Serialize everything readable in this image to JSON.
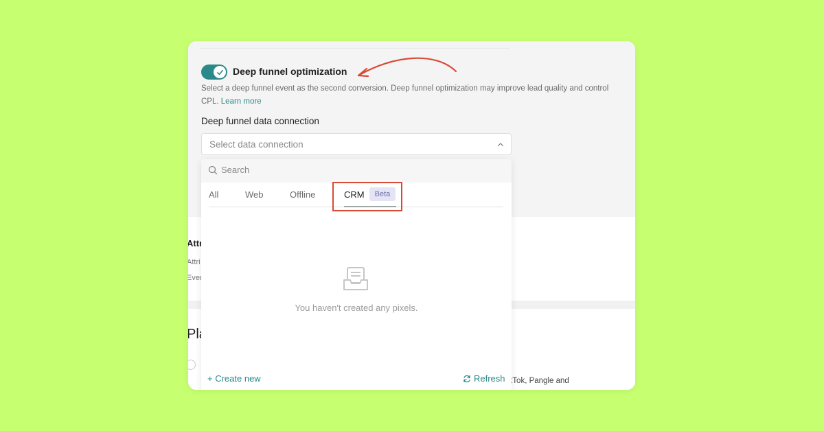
{
  "colors": {
    "page_background": "#c6ff70",
    "accent": "#2b8a89",
    "annotation": "#d94a36",
    "beta_badge_bg": "#e4e4f6"
  },
  "deep_funnel": {
    "toggle_on": true,
    "title": "Deep funnel optimization",
    "description": "Select a deep funnel event as the second conversion. Deep funnel optimization may improve lead quality and control CPL.",
    "learn_more": "Learn more"
  },
  "data_connection": {
    "label": "Deep funnel data connection",
    "placeholder": "Select data connection"
  },
  "dropdown": {
    "search_placeholder": "Search",
    "tabs": [
      {
        "label": "All"
      },
      {
        "label": "Web"
      },
      {
        "label": "Offline"
      },
      {
        "label": "CRM",
        "badge": "Beta",
        "active": true
      }
    ],
    "empty_message": "You haven't created any pixels.",
    "create_new": "+ Create new",
    "refresh": "Refresh"
  },
  "background_fragments": {
    "attr_heading": "Attri",
    "attr_desc": "Attri",
    "event_fragment": "Even",
    "placement_heading": "Pla",
    "tiktok_text": "ikTok, Pangle and"
  },
  "icons": [
    "check-icon",
    "chevron-up-icon",
    "search-icon",
    "inbox-icon",
    "refresh-icon"
  ]
}
